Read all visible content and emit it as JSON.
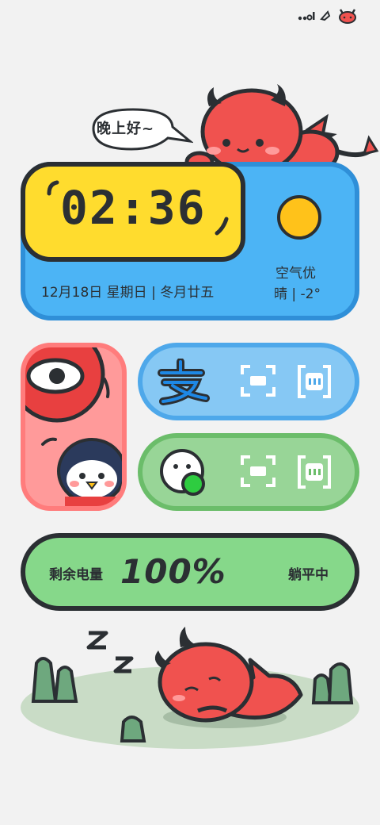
{
  "status_bar": {
    "icons": [
      "signal-dots-icon",
      "wifi-icon",
      "devil-face-icon"
    ]
  },
  "greeting": {
    "text": "晚上好~"
  },
  "clock": {
    "time": "02:36",
    "date": "12月18日  星期日 | 冬月廿五",
    "air_quality": "空气优",
    "weather": "晴 | -2°"
  },
  "apps": {
    "alipay": {
      "icon": "alipay-icon",
      "scan_icon": "scan-icon",
      "code_icon": "pay-code-icon"
    },
    "wechat": {
      "icon": "wechat-icon",
      "scan_icon": "scan-icon",
      "code_icon": "pay-code-icon"
    }
  },
  "battery": {
    "label": "剩余电量",
    "value": "100%",
    "status": "躺平中"
  },
  "colors": {
    "background": "#f2f2f2",
    "yellow": "#ffdc2e",
    "blue": "#4cb4f5",
    "pink": "#ff9a9a",
    "green": "#86d88a",
    "red_devil": "#f0524f",
    "outline": "#2b2f33"
  }
}
